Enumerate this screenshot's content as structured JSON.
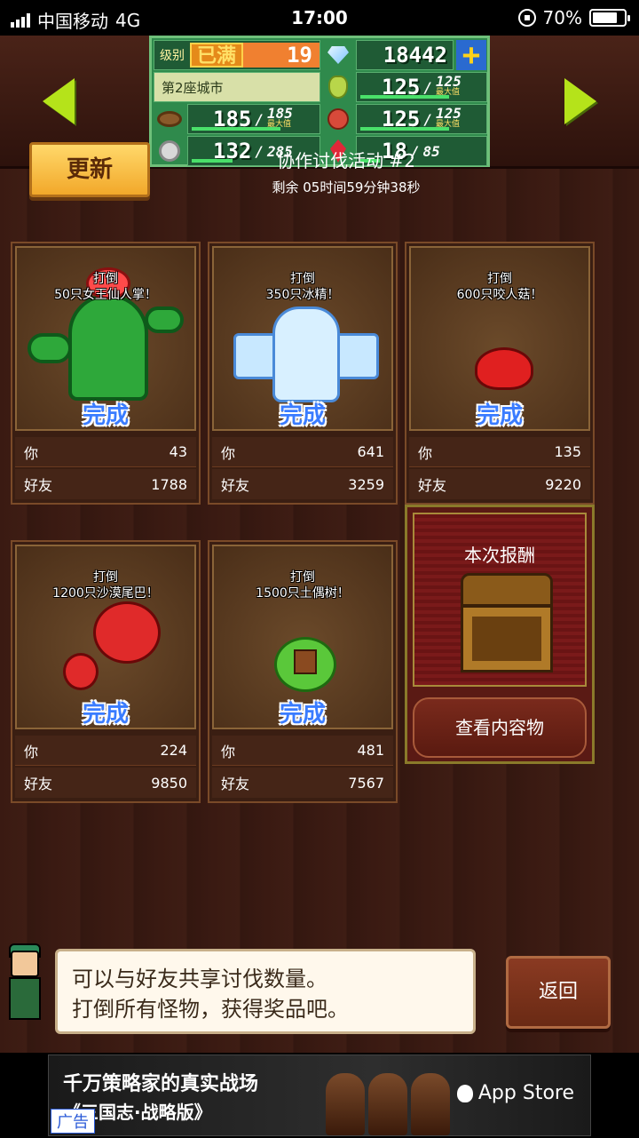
{
  "status_bar": {
    "carrier": "中国移动",
    "network": "4G",
    "time": "17:00",
    "battery": "70%"
  },
  "resources": {
    "level_label": "级别",
    "level_status": "已满",
    "level": "19",
    "gems": "18442",
    "city": "第2座城市",
    "wood": "185",
    "wood_max": "185",
    "wood_max_tag": "最大值",
    "food": "125",
    "food_max": "125",
    "food_max_tag": "最大值",
    "fruit": "125",
    "fruit_max": "125",
    "fruit_max_tag": "最大值",
    "coins": "132",
    "coins_max": "285",
    "ruby": "18",
    "ruby_max": "85",
    "bar_fill": {
      "wood": 1.0,
      "food": 1.0,
      "fruit": 1.0,
      "coins": 0.46,
      "ruby": 0.21
    }
  },
  "event": {
    "update_button": "更新",
    "title": "协作讨伐活动 #2",
    "remaining": "剩余 05时间59分钟38秒"
  },
  "missions": [
    {
      "line1": "打倒",
      "line2": "50只女王仙人掌！",
      "status": "完成",
      "you_label": "你",
      "you": "43",
      "friends_label": "好友",
      "friends": "1788"
    },
    {
      "line1": "打倒",
      "line2": "350只冰精！",
      "status": "完成",
      "you_label": "你",
      "you": "641",
      "friends_label": "好友",
      "friends": "3259"
    },
    {
      "line1": "打倒",
      "line2": "600只咬人菇！",
      "status": "完成",
      "you_label": "你",
      "you": "135",
      "friends_label": "好友",
      "friends": "9220"
    },
    {
      "line1": "打倒",
      "line2": "1200只沙漠尾巴！",
      "status": "完成",
      "you_label": "你",
      "you": "224",
      "friends_label": "好友",
      "friends": "9850"
    },
    {
      "line1": "打倒",
      "line2": "1500只土偶树！",
      "status": "完成",
      "you_label": "你",
      "you": "481",
      "friends_label": "好友",
      "friends": "7567"
    }
  ],
  "reward": {
    "title": "本次报酬",
    "view_button": "查看内容物"
  },
  "dialog": {
    "line1": "可以与好友共享讨伐数量。",
    "line2": "打倒所有怪物，获得奖品吧。",
    "back_button": "返回"
  },
  "ad": {
    "line1": "千万策略家的真实战场",
    "line2": "《三国志·战略版》",
    "store": "App Store",
    "tag": "广告"
  }
}
